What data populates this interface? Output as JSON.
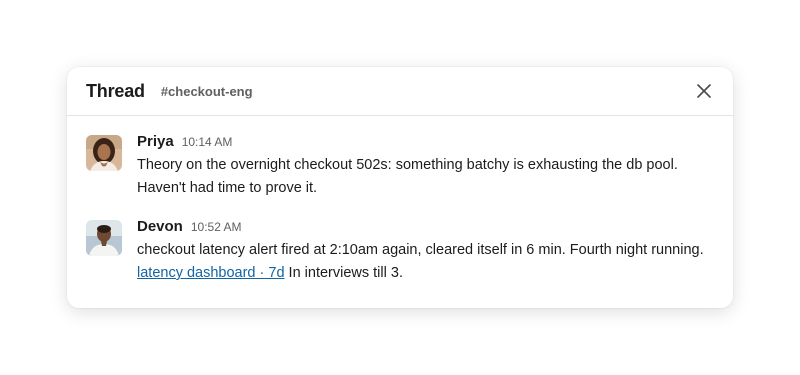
{
  "thread": {
    "title": "Thread",
    "channel": "#checkout-eng"
  },
  "messages": [
    {
      "author": "Priya",
      "time": "10:14 AM",
      "line1": "Theory on the overnight checkout 502s: something batchy is exhausting the db pool.",
      "line2": "Haven't had time to prove it."
    },
    {
      "author": "Devon",
      "time": "10:52 AM",
      "line1": "checkout latency alert fired at 2:10am again, cleared itself in 6 min. Fourth night running.",
      "link_text": "latency dashboard · 7d",
      "after_link": " In interviews till 3."
    }
  ],
  "colors": {
    "text": "#1d1c1d",
    "muted": "#616061",
    "link": "#1264a3"
  },
  "icons": {
    "close": "close-icon"
  }
}
